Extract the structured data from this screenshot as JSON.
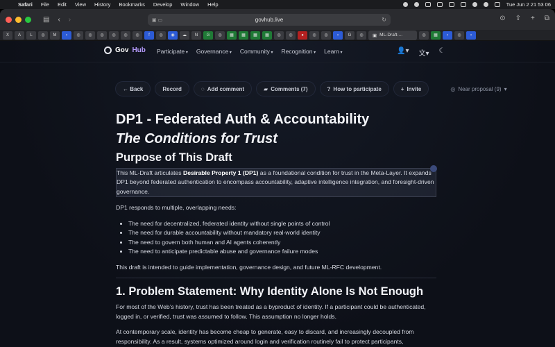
{
  "menubar": {
    "app": "Safari",
    "items": [
      "File",
      "Edit",
      "View",
      "History",
      "Bookmarks",
      "Develop",
      "Window",
      "Help"
    ],
    "datetime": "Tue Jun 2  21 53 06"
  },
  "browser": {
    "url": "govhub.live",
    "active_tab": "ML-Draft-..."
  },
  "site": {
    "logo_gov": "Gov",
    "logo_hub": "Hub",
    "nav": [
      "Participate",
      "Governance",
      "Community",
      "Recognition",
      "Learn"
    ]
  },
  "actions": {
    "back": "← Back",
    "record": "Record",
    "add_comment": "Add comment",
    "comments": "Comments (7)",
    "how": "How to participate",
    "invite": "Invite",
    "near": "Near proposal (9)"
  },
  "doc": {
    "title": "DP1 - Federated Auth & Accountability",
    "subtitle": "The Conditions for Trust",
    "purpose_heading": "Purpose of This Draft",
    "purpose_p1_pre": "This ML-Draft articulates ",
    "purpose_p1_bold": "Desirable Property 1 (DP1)",
    "purpose_p1_post": " as a foundational condition for trust in the Meta-Layer. It expands DP1 beyond federated authentication to encompass accountability, adaptive intelligence integration, and foresight-driven governance.",
    "needs_intro": "DP1 responds to multiple, overlapping needs:",
    "needs": [
      "The need for decentralized, federated identity without single points of control",
      "The need for durable accountability without mandatory real-world identity",
      "The need to govern both human and AI agents coherently",
      "The need to anticipate predictable abuse and governance failure modes"
    ],
    "intended": "This draft is intended to guide implementation, governance design, and future ML-RFC development.",
    "section1_heading": "1. Problem Statement: Why Identity Alone Is Not Enough",
    "section1_p1": "For most of the Web’s history, trust has been treated as a byproduct of identity. If a participant could be authenticated, logged in, or verified, trust was assumed to follow. This assumption no longer holds.",
    "section1_p2": "At contemporary scale, identity has become cheap to generate, easy to discard, and increasingly decoupled from responsibility. As a result, systems optimized around login and verification routinely fail to protect participants,"
  }
}
